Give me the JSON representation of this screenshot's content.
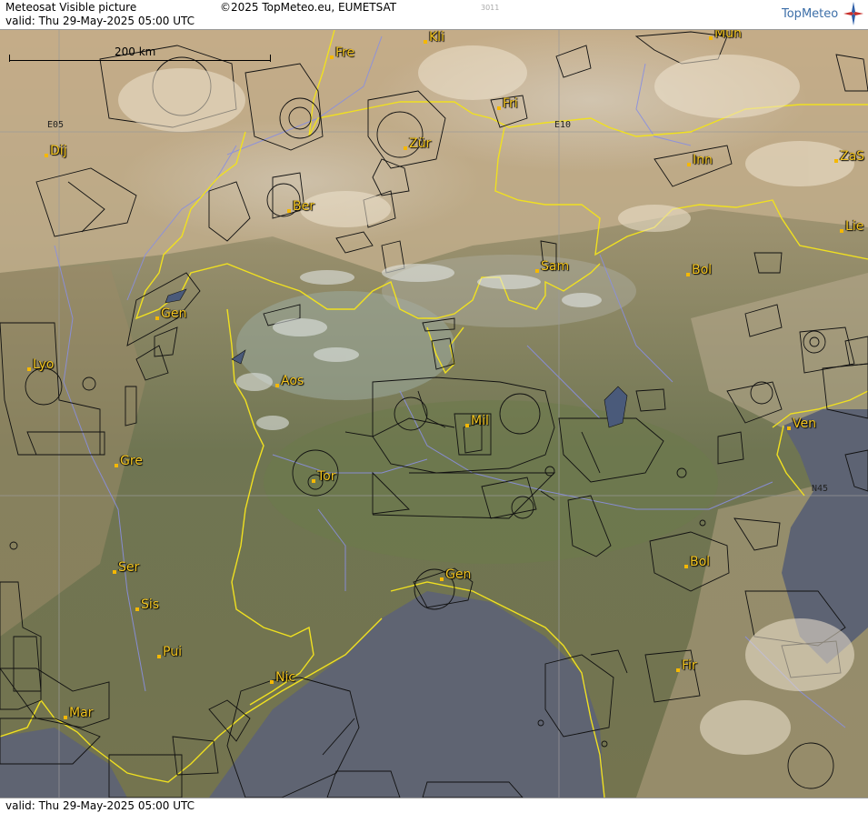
{
  "header": {
    "title": "Meteosat Visible picture",
    "valid": "valid:  Thu  29-May-2025  05:00 UTC",
    "copyright": "©2025 TopMeteo.eu, EUMETSAT",
    "code": "3011",
    "logo": "TopMeteo"
  },
  "footer": {
    "valid": "valid:  Thu  29-May-2025  05:00 UTC"
  },
  "scale": {
    "label": "200 km"
  },
  "gridlabels": {
    "e05": "E05",
    "e10": "E10",
    "n45": "N45"
  },
  "cities": [
    "Fre",
    "Kli",
    "Mün",
    "Fri",
    "Zür",
    "Dij",
    "Ber",
    "Inn",
    "ZaS",
    "Lie",
    "Sam",
    "Bol",
    "Gen",
    "Lyo",
    "Aos",
    "Mil",
    "Ven",
    "Gre",
    "Tor",
    "Ser",
    "Gen",
    "Bol",
    "Sis",
    "Pui",
    "Nic",
    "Fir",
    "Mar"
  ],
  "colors": {
    "border": "#f0e020",
    "river": "#8a8fe0",
    "airspace": "#000000",
    "city": "#f3c520",
    "sea": "#5d6373"
  }
}
